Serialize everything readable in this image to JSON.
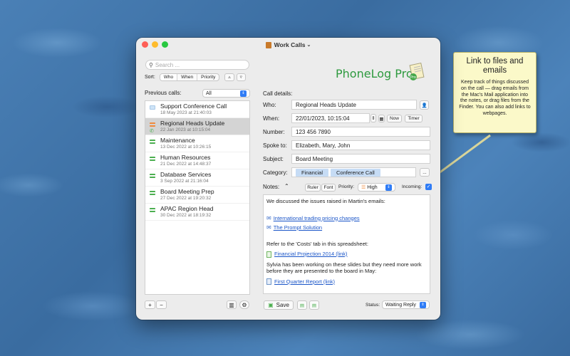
{
  "window": {
    "title": "Work Calls"
  },
  "search": {
    "placeholder": "Search ..."
  },
  "sort": {
    "label": "Sort:",
    "options": [
      "Who",
      "When",
      "Priority"
    ],
    "asc": "▵",
    "desc": "▿"
  },
  "previous_calls": {
    "label": "Previous calls:",
    "filter": "All",
    "items": [
      {
        "title": "Support Conference Call",
        "date": "18 May 2023 at 21:40:03"
      },
      {
        "title": "Regional Heads Update",
        "date": "22 Jan 2023 at 10:15:04"
      },
      {
        "title": "Maintenance",
        "date": "13 Dec 2022 at 10:26:15"
      },
      {
        "title": "Human Resources",
        "date": "21 Dec 2022 at 14:48:37"
      },
      {
        "title": "Database Services",
        "date": "3 Sep 2022 at 21:16:04"
      },
      {
        "title": "Board Meeting Prep",
        "date": "27 Dec 2022 at 19:20:32"
      },
      {
        "title": "APAC Region Head",
        "date": "30 Dec 2022 at 18:19:32"
      }
    ],
    "add": "+",
    "remove": "−"
  },
  "logo": {
    "text": "PhoneLog Pro"
  },
  "details": {
    "heading": "Call details:",
    "who_label": "Who:",
    "who": "Regional Heads Update",
    "when_label": "When:",
    "when": "22/01/2023, 10:15:04",
    "now": "Now",
    "timer": "Timer",
    "number_label": "Number:",
    "number": "123 456 7890",
    "spoke_label": "Spoke to:",
    "spoke": "Elizabeth, Mary, John",
    "subject_label": "Subject:",
    "subject": "Board Meeting",
    "category_label": "Category:",
    "categories": [
      "Financial",
      "Conference Call"
    ],
    "more": "..."
  },
  "notes": {
    "label": "Notes:",
    "ruler": "Ruler",
    "font": "Font",
    "priority_label": "Priority:",
    "priority": "High",
    "incoming_label": "Incoming:",
    "line1": "We discussed the issues raised in Martin's emails:",
    "link1": "International trading pricing changes",
    "link2": "The Prompt Solution",
    "line2": "Refer to the 'Costs' tab in this spreadsheet:",
    "link3": "Financial Projection 2014 (link)",
    "line3": "Sylvia has been working on these slides but they need more work before they are presented to the board in May:",
    "link4": "First Quarter Report (link)"
  },
  "footer": {
    "save": "Save",
    "status_label": "Status:",
    "status": "Waiting Reply"
  },
  "tooltip": {
    "title": "Link to files and emails",
    "body": "Keep track of things discussed on the call — drag emails from the Mac's Mail application into the notes, or drag files from the Finder. You can also add links to webpages."
  }
}
